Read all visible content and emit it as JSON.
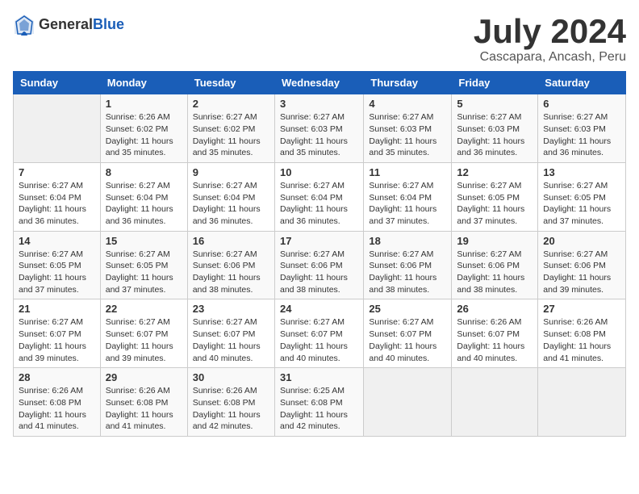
{
  "header": {
    "logo_general": "General",
    "logo_blue": "Blue",
    "title": "July 2024",
    "subtitle": "Cascapara, Ancash, Peru"
  },
  "weekdays": [
    "Sunday",
    "Monday",
    "Tuesday",
    "Wednesday",
    "Thursday",
    "Friday",
    "Saturday"
  ],
  "weeks": [
    [
      {
        "day": "",
        "info": ""
      },
      {
        "day": "1",
        "info": "Sunrise: 6:26 AM\nSunset: 6:02 PM\nDaylight: 11 hours\nand 35 minutes."
      },
      {
        "day": "2",
        "info": "Sunrise: 6:27 AM\nSunset: 6:02 PM\nDaylight: 11 hours\nand 35 minutes."
      },
      {
        "day": "3",
        "info": "Sunrise: 6:27 AM\nSunset: 6:03 PM\nDaylight: 11 hours\nand 35 minutes."
      },
      {
        "day": "4",
        "info": "Sunrise: 6:27 AM\nSunset: 6:03 PM\nDaylight: 11 hours\nand 35 minutes."
      },
      {
        "day": "5",
        "info": "Sunrise: 6:27 AM\nSunset: 6:03 PM\nDaylight: 11 hours\nand 36 minutes."
      },
      {
        "day": "6",
        "info": "Sunrise: 6:27 AM\nSunset: 6:03 PM\nDaylight: 11 hours\nand 36 minutes."
      }
    ],
    [
      {
        "day": "7",
        "info": "Sunrise: 6:27 AM\nSunset: 6:04 PM\nDaylight: 11 hours\nand 36 minutes."
      },
      {
        "day": "8",
        "info": "Sunrise: 6:27 AM\nSunset: 6:04 PM\nDaylight: 11 hours\nand 36 minutes."
      },
      {
        "day": "9",
        "info": "Sunrise: 6:27 AM\nSunset: 6:04 PM\nDaylight: 11 hours\nand 36 minutes."
      },
      {
        "day": "10",
        "info": "Sunrise: 6:27 AM\nSunset: 6:04 PM\nDaylight: 11 hours\nand 36 minutes."
      },
      {
        "day": "11",
        "info": "Sunrise: 6:27 AM\nSunset: 6:04 PM\nDaylight: 11 hours\nand 37 minutes."
      },
      {
        "day": "12",
        "info": "Sunrise: 6:27 AM\nSunset: 6:05 PM\nDaylight: 11 hours\nand 37 minutes."
      },
      {
        "day": "13",
        "info": "Sunrise: 6:27 AM\nSunset: 6:05 PM\nDaylight: 11 hours\nand 37 minutes."
      }
    ],
    [
      {
        "day": "14",
        "info": "Sunrise: 6:27 AM\nSunset: 6:05 PM\nDaylight: 11 hours\nand 37 minutes."
      },
      {
        "day": "15",
        "info": "Sunrise: 6:27 AM\nSunset: 6:05 PM\nDaylight: 11 hours\nand 37 minutes."
      },
      {
        "day": "16",
        "info": "Sunrise: 6:27 AM\nSunset: 6:06 PM\nDaylight: 11 hours\nand 38 minutes."
      },
      {
        "day": "17",
        "info": "Sunrise: 6:27 AM\nSunset: 6:06 PM\nDaylight: 11 hours\nand 38 minutes."
      },
      {
        "day": "18",
        "info": "Sunrise: 6:27 AM\nSunset: 6:06 PM\nDaylight: 11 hours\nand 38 minutes."
      },
      {
        "day": "19",
        "info": "Sunrise: 6:27 AM\nSunset: 6:06 PM\nDaylight: 11 hours\nand 38 minutes."
      },
      {
        "day": "20",
        "info": "Sunrise: 6:27 AM\nSunset: 6:06 PM\nDaylight: 11 hours\nand 39 minutes."
      }
    ],
    [
      {
        "day": "21",
        "info": "Sunrise: 6:27 AM\nSunset: 6:07 PM\nDaylight: 11 hours\nand 39 minutes."
      },
      {
        "day": "22",
        "info": "Sunrise: 6:27 AM\nSunset: 6:07 PM\nDaylight: 11 hours\nand 39 minutes."
      },
      {
        "day": "23",
        "info": "Sunrise: 6:27 AM\nSunset: 6:07 PM\nDaylight: 11 hours\nand 40 minutes."
      },
      {
        "day": "24",
        "info": "Sunrise: 6:27 AM\nSunset: 6:07 PM\nDaylight: 11 hours\nand 40 minutes."
      },
      {
        "day": "25",
        "info": "Sunrise: 6:27 AM\nSunset: 6:07 PM\nDaylight: 11 hours\nand 40 minutes."
      },
      {
        "day": "26",
        "info": "Sunrise: 6:26 AM\nSunset: 6:07 PM\nDaylight: 11 hours\nand 40 minutes."
      },
      {
        "day": "27",
        "info": "Sunrise: 6:26 AM\nSunset: 6:08 PM\nDaylight: 11 hours\nand 41 minutes."
      }
    ],
    [
      {
        "day": "28",
        "info": "Sunrise: 6:26 AM\nSunset: 6:08 PM\nDaylight: 11 hours\nand 41 minutes."
      },
      {
        "day": "29",
        "info": "Sunrise: 6:26 AM\nSunset: 6:08 PM\nDaylight: 11 hours\nand 41 minutes."
      },
      {
        "day": "30",
        "info": "Sunrise: 6:26 AM\nSunset: 6:08 PM\nDaylight: 11 hours\nand 42 minutes."
      },
      {
        "day": "31",
        "info": "Sunrise: 6:25 AM\nSunset: 6:08 PM\nDaylight: 11 hours\nand 42 minutes."
      },
      {
        "day": "",
        "info": ""
      },
      {
        "day": "",
        "info": ""
      },
      {
        "day": "",
        "info": ""
      }
    ]
  ]
}
